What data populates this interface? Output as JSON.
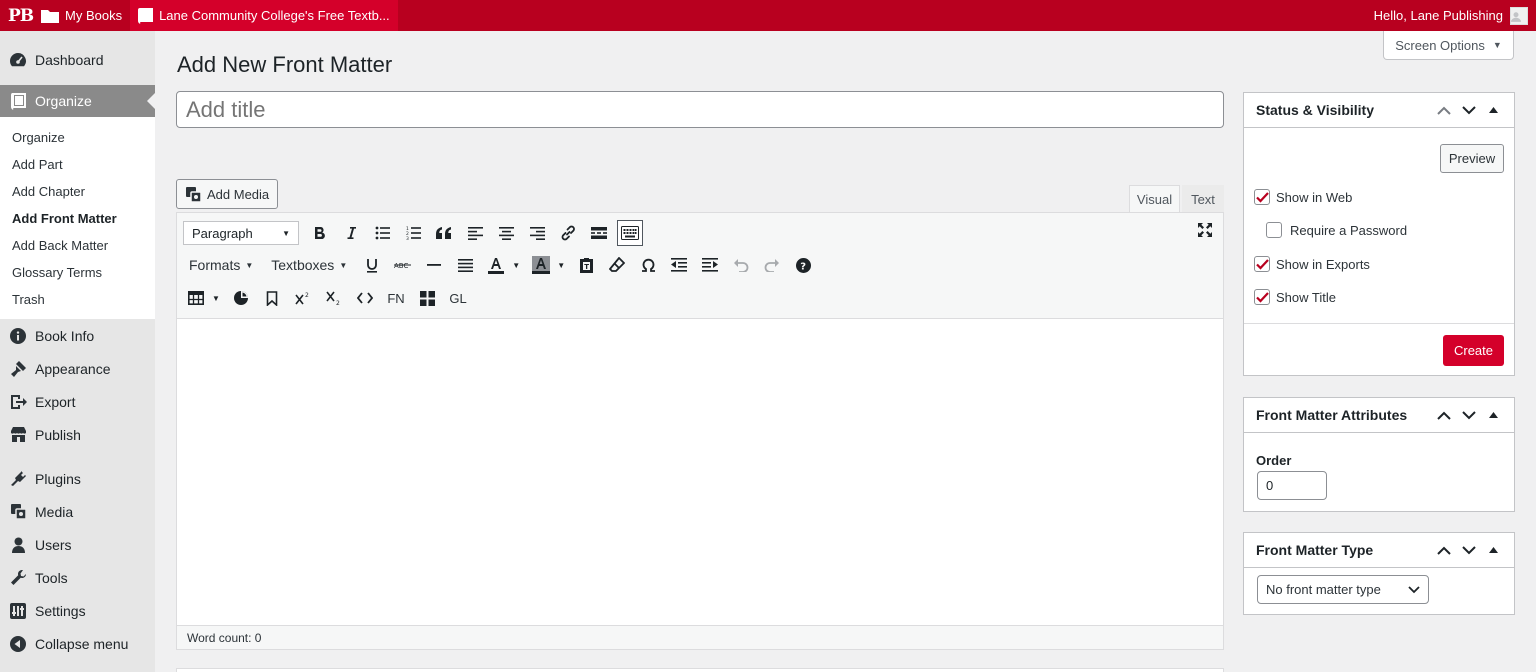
{
  "admin_bar": {
    "logo": "PB",
    "my_books": "My Books",
    "site_name": "Lane Community College's Free Textb...",
    "greeting": "Hello, Lane Publishing"
  },
  "sidebar": {
    "items_top": [
      {
        "label": "Dashboard",
        "icon": "dashboard-icon"
      },
      {
        "label": "Organize",
        "icon": "book-icon",
        "current": true
      }
    ],
    "submenu": [
      {
        "label": "Organize"
      },
      {
        "label": "Add Part"
      },
      {
        "label": "Add Chapter"
      },
      {
        "label": "Add Front Matter",
        "active": true
      },
      {
        "label": "Add Back Matter"
      },
      {
        "label": "Glossary Terms"
      },
      {
        "label": "Trash"
      }
    ],
    "items_mid": [
      {
        "label": "Book Info",
        "icon": "info-icon"
      },
      {
        "label": "Appearance",
        "icon": "paintbrush-icon"
      },
      {
        "label": "Export",
        "icon": "export-icon"
      },
      {
        "label": "Publish",
        "icon": "store-icon"
      }
    ],
    "items_bottom": [
      {
        "label": "Plugins",
        "icon": "plugin-icon"
      },
      {
        "label": "Media",
        "icon": "media-icon"
      },
      {
        "label": "Users",
        "icon": "user-icon"
      },
      {
        "label": "Tools",
        "icon": "wrench-icon"
      },
      {
        "label": "Settings",
        "icon": "settings-icon"
      },
      {
        "label": "Collapse menu",
        "icon": "collapse-icon"
      }
    ]
  },
  "screen_options": "Screen Options",
  "page_title": "Add New Front Matter",
  "title_placeholder": "Add title",
  "editor": {
    "add_media": "Add Media",
    "tab_visual": "Visual",
    "tab_text": "Text",
    "format_select": "Paragraph",
    "formats": "Formats",
    "textboxes": "Textboxes",
    "fn": "FN",
    "gl": "GL",
    "word_count": "Word count: 0"
  },
  "status_box": {
    "title": "Status & Visibility",
    "preview": "Preview",
    "show_in_web": "Show in Web",
    "require_password": "Require a Password",
    "show_in_exports": "Show in Exports",
    "show_title": "Show Title",
    "create": "Create",
    "checks": {
      "show_in_web": true,
      "require_password": false,
      "show_in_exports": true,
      "show_title": true
    }
  },
  "attributes_box": {
    "title": "Front Matter Attributes",
    "order_label": "Order",
    "order_value": "0"
  },
  "type_box": {
    "title": "Front Matter Type",
    "selected": "No front matter type"
  },
  "colors": {
    "admin_bar": "#b8001f",
    "accent": "#d4002a",
    "checkmark": "#b8001f"
  }
}
